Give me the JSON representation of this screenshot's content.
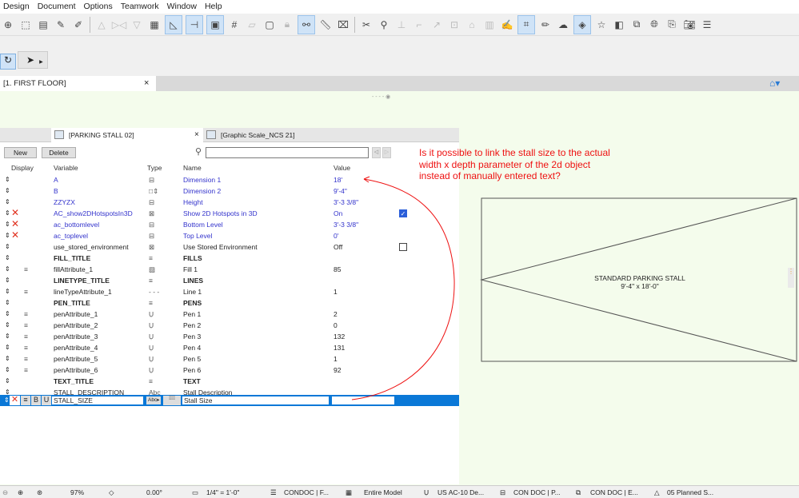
{
  "menu": [
    "Design",
    "Document",
    "Options",
    "Teamwork",
    "Window",
    "Help"
  ],
  "floor_tab": {
    "label": "[1. FIRST FLOOR]",
    "close": "×"
  },
  "panel": {
    "tabs": [
      {
        "label": "[PARKING STALL 02]",
        "close": "×"
      },
      {
        "label": "[Graphic Scale_NCS 21]"
      }
    ],
    "new_label": "New",
    "delete_label": "Delete",
    "search_placeholder": "",
    "headers": {
      "display": "Display",
      "variable": "Variable",
      "type": "Type",
      "name": "Name",
      "value": "Value"
    },
    "rows": [
      {
        "variable": "A",
        "type_icon": "dimension-a-icon",
        "type": "⊟",
        "name": "Dimension 1",
        "value": "18'",
        "blue": true
      },
      {
        "variable": "B",
        "type_icon": "dimension-b-icon",
        "type": "□⇕",
        "name": "Dimension 2",
        "value": "9'-4\"",
        "blue": true
      },
      {
        "variable": "ZZYZX",
        "type_icon": "length-icon",
        "type": "⊟",
        "name": "Height",
        "value": "3'-3 3/8\"",
        "blue": true
      },
      {
        "variable": "AC_show2DHotspotsIn3D",
        "type_icon": "boolean-icon",
        "type": "⊠",
        "name": "Show 2D Hotspots in 3D",
        "value": "On",
        "blue": true,
        "x": true,
        "checkbox": "on"
      },
      {
        "variable": "ac_bottomlevel",
        "type_icon": "length-icon",
        "type": "⊟",
        "name": "Bottom Level",
        "value": "3'-3 3/8\"",
        "blue": true,
        "x": true
      },
      {
        "variable": "ac_toplevel",
        "type_icon": "length-icon",
        "type": "⊟",
        "name": "Top Level",
        "value": "0'",
        "blue": true,
        "x": true
      },
      {
        "variable": "use_stored_environment",
        "type_icon": "boolean-icon",
        "type": "⊠",
        "name": "Use Stored Environment",
        "value": "Off",
        "checkbox": "off"
      },
      {
        "variable": "FILL_TITLE",
        "type_icon": "title-icon",
        "type": "≡",
        "name": "FILLS",
        "value": "",
        "bold": true
      },
      {
        "variable": "fillAttribute_1",
        "type_icon": "fill-icon",
        "type": "▨",
        "name": "Fill 1",
        "value": "85",
        "indent": true
      },
      {
        "variable": "LINETYPE_TITLE",
        "type_icon": "title-icon",
        "type": "≡",
        "name": "LINES",
        "value": "",
        "bold": true
      },
      {
        "variable": "lineTypeAttribute_1",
        "type_icon": "linetype-icon",
        "type": "- - -",
        "name": "Line 1",
        "value": "1",
        "indent": true
      },
      {
        "variable": "PEN_TITLE",
        "type_icon": "title-icon",
        "type": "≡",
        "name": "PENS",
        "value": "",
        "bold": true
      },
      {
        "variable": "penAttribute_1",
        "type_icon": "pen-icon",
        "type": "Ụ",
        "name": "Pen 1",
        "value": "2",
        "indent": true
      },
      {
        "variable": "penAttribute_2",
        "type_icon": "pen-icon",
        "type": "Ụ",
        "name": "Pen 2",
        "value": "0",
        "indent": true
      },
      {
        "variable": "penAttribute_3",
        "type_icon": "pen-icon",
        "type": "Ụ",
        "name": "Pen 3",
        "value": "132",
        "indent": true
      },
      {
        "variable": "penAttribute_4",
        "type_icon": "pen-icon",
        "type": "Ụ",
        "name": "Pen 4",
        "value": "131",
        "indent": true
      },
      {
        "variable": "penAttribute_5",
        "type_icon": "pen-icon",
        "type": "Ụ",
        "name": "Pen 5",
        "value": "1",
        "indent": true
      },
      {
        "variable": "penAttribute_6",
        "type_icon": "pen-icon",
        "type": "Ụ",
        "name": "Pen 6",
        "value": "92",
        "indent": true
      },
      {
        "variable": "TEXT_TITLE",
        "type_icon": "title-icon",
        "type": "≡",
        "name": "TEXT",
        "value": "",
        "bold": true
      },
      {
        "variable": "STALL_DESCRIPTION",
        "type_icon": "text-icon",
        "type": "Abc",
        "name": "Stall Description",
        "value": ""
      }
    ],
    "edit_row": {
      "variable": "STALL_SIZE",
      "type": "Abc▸",
      "name": "Stall Size",
      "value": "",
      "bold_label": "B",
      "underline_label": "U"
    }
  },
  "annotation": "Is it possible to link the stall size to the actual width x depth parameter of the 2d object instead of manually entered text?",
  "drawing": {
    "title": "STANDARD PARKING STALL",
    "size": "9'-4\" x 18'-0\""
  },
  "status": {
    "zoom": "97%",
    "angle": "0.00°",
    "scale": "1/4\"  =  1'-0\"",
    "layers": "CONDOC | F...",
    "model": "Entire Model",
    "pens": "US AC-10 De...",
    "view1": "CON DOC | P...",
    "view2": "CON DOC | E...",
    "renovation": "05 Planned S..."
  },
  "colors": {
    "accent": "#0a78d7",
    "annotation": "#ee1111",
    "canvas": "#f4fcec",
    "param_blue": "#3333cc"
  }
}
